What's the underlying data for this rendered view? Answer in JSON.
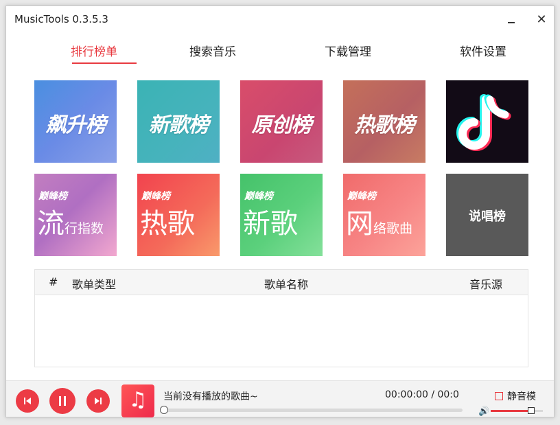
{
  "window": {
    "title": "MusicTools 0.3.5.3",
    "minimize": "",
    "close": "✕"
  },
  "tabs": [
    {
      "label": "排行榜单",
      "active": true
    },
    {
      "label": "搜索音乐",
      "active": false
    },
    {
      "label": "下载管理",
      "active": false
    },
    {
      "label": "软件设置",
      "active": false
    }
  ],
  "charts_row1": [
    {
      "label": "飙升榜",
      "icon": "soaring-chart-cover"
    },
    {
      "label": "新歌榜",
      "icon": "new-songs-chart-cover"
    },
    {
      "label": "原创榜",
      "icon": "original-chart-cover"
    },
    {
      "label": "热歌榜",
      "icon": "hot-songs-chart-cover"
    },
    {
      "label": "",
      "icon": "tiktok-logo"
    }
  ],
  "charts_row2": [
    {
      "brand": "巅峰榜",
      "main": "流",
      "sub": "行指数"
    },
    {
      "brand": "巅峰榜",
      "main": "热歌",
      "sub": ""
    },
    {
      "brand": "巅峰榜",
      "main": "新歌",
      "sub": ""
    },
    {
      "brand": "巅峰榜",
      "main": "网",
      "sub": "络歌曲"
    },
    {
      "label": "说唱榜"
    }
  ],
  "table": {
    "columns": [
      "#",
      "歌单类型",
      "歌单名称",
      "音乐源"
    ],
    "rows": []
  },
  "player": {
    "prev_icon": "skip-previous-icon",
    "play_icon": "pause-icon",
    "next_icon": "skip-next-icon",
    "cover_icon": "music-note-icon",
    "now_playing": "当前没有播放的歌曲~",
    "time": "00:00:00 / 00:0",
    "progress": 0,
    "mute_label": "静音模",
    "mute_checked": false,
    "volume": 0.78,
    "accent": "#e8393f"
  }
}
